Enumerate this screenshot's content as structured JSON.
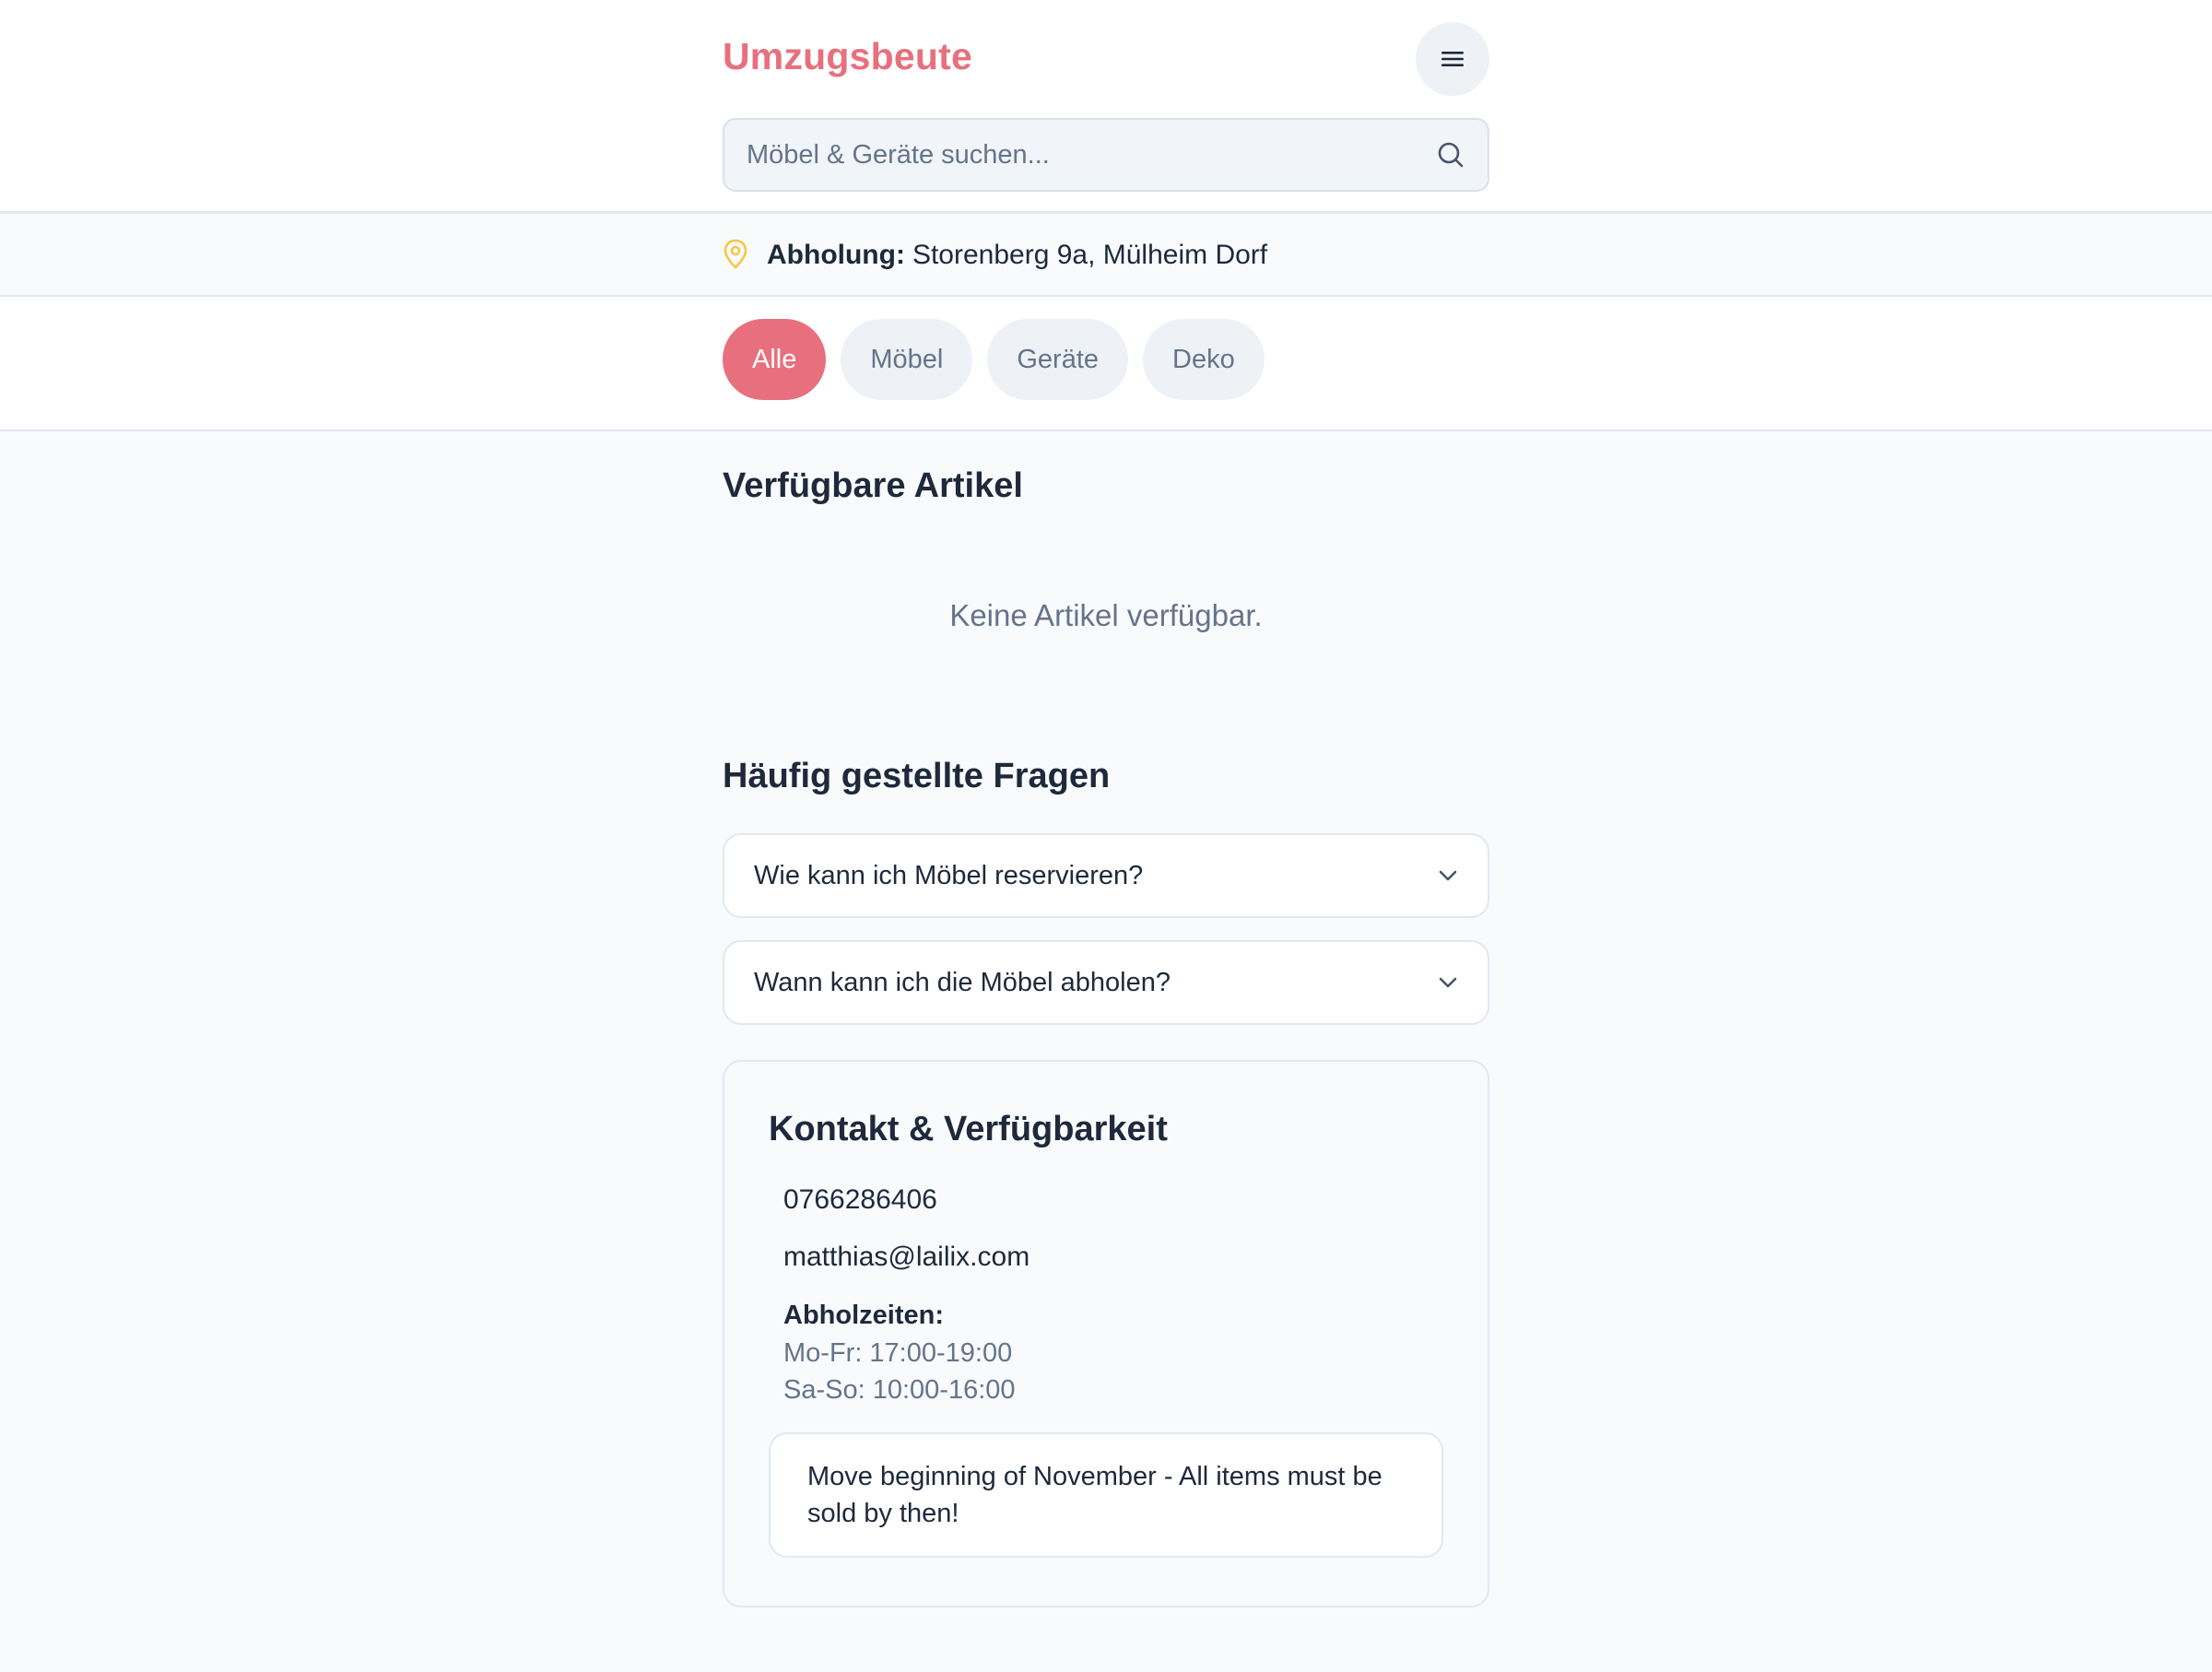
{
  "header": {
    "brand": "Umzugsbeute",
    "menu_icon": "menu-icon",
    "search": {
      "placeholder": "Möbel & Geräte suchen...",
      "value": "",
      "icon": "search-icon"
    }
  },
  "pickup": {
    "icon": "map-pin-icon",
    "label": "Abholung:",
    "address": "Storenberg 9a, Mülheim Dorf"
  },
  "filters": [
    {
      "label": "Alle",
      "active": true
    },
    {
      "label": "Möbel",
      "active": false
    },
    {
      "label": "Geräte",
      "active": false
    },
    {
      "label": "Deko",
      "active": false
    }
  ],
  "items_section": {
    "title": "Verfügbare Artikel",
    "empty_text": "Keine Artikel verfügbar."
  },
  "faq": {
    "title": "Häufig gestellte Fragen",
    "questions": [
      {
        "question": "Wie kann ich Möbel reservieren?"
      },
      {
        "question": "Wann kann ich die Möbel abholen?"
      }
    ]
  },
  "contact": {
    "title": "Kontakt & Verfügbarkeit",
    "phone": "0766286406",
    "email": "matthias@lailix.com",
    "hours_label": "Abholzeiten:",
    "hours": [
      "Mo-Fr: 17:00-19:00",
      "Sa-So: 10:00-16:00"
    ],
    "notice": "Move beginning of November - All items must be sold by then!"
  },
  "colors": {
    "accent": "#e8707e",
    "pin": "#f5c842",
    "text": "#1e293b",
    "muted": "#64748b"
  }
}
